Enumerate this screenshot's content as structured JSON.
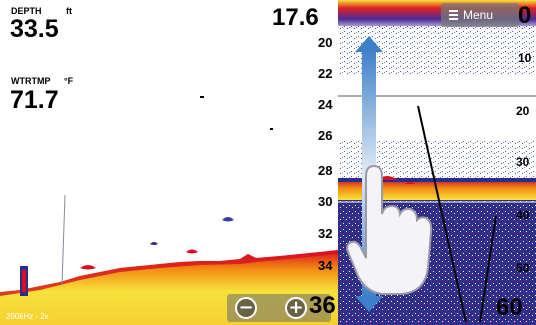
{
  "left_panel": {
    "depth_label": "DEPTH",
    "depth_unit": "ft",
    "depth_value": "33.5",
    "watertemp_label": "WTRTMP",
    "watertemp_unit": "°F",
    "watertemp_value": "71.7",
    "range_top": "17.6",
    "depth_scale": [
      "20",
      "22",
      "24",
      "26",
      "28",
      "30",
      "32",
      "34"
    ],
    "bottom_scale_value": "36",
    "frequency_label": "200kHz - 2x"
  },
  "zoom": {
    "zoom_out_label": "−",
    "zoom_in_label": "+"
  },
  "right_panel": {
    "menu_label": "Menu",
    "upper_scale": [
      "0",
      "10"
    ],
    "lower_scale": [
      "20",
      "30",
      "40",
      "50",
      "60"
    ]
  },
  "colors": {
    "echo_red": "#d8101a",
    "echo_orange": "#f28a12",
    "echo_yellow": "#f7e23a",
    "echo_blue": "#232a8c",
    "arrow_blue": "#4a8fd0"
  },
  "icons": [
    "menu-icon",
    "zoom-out-icon",
    "zoom-in-icon",
    "drag-gesture-icon",
    "hand-icon"
  ]
}
